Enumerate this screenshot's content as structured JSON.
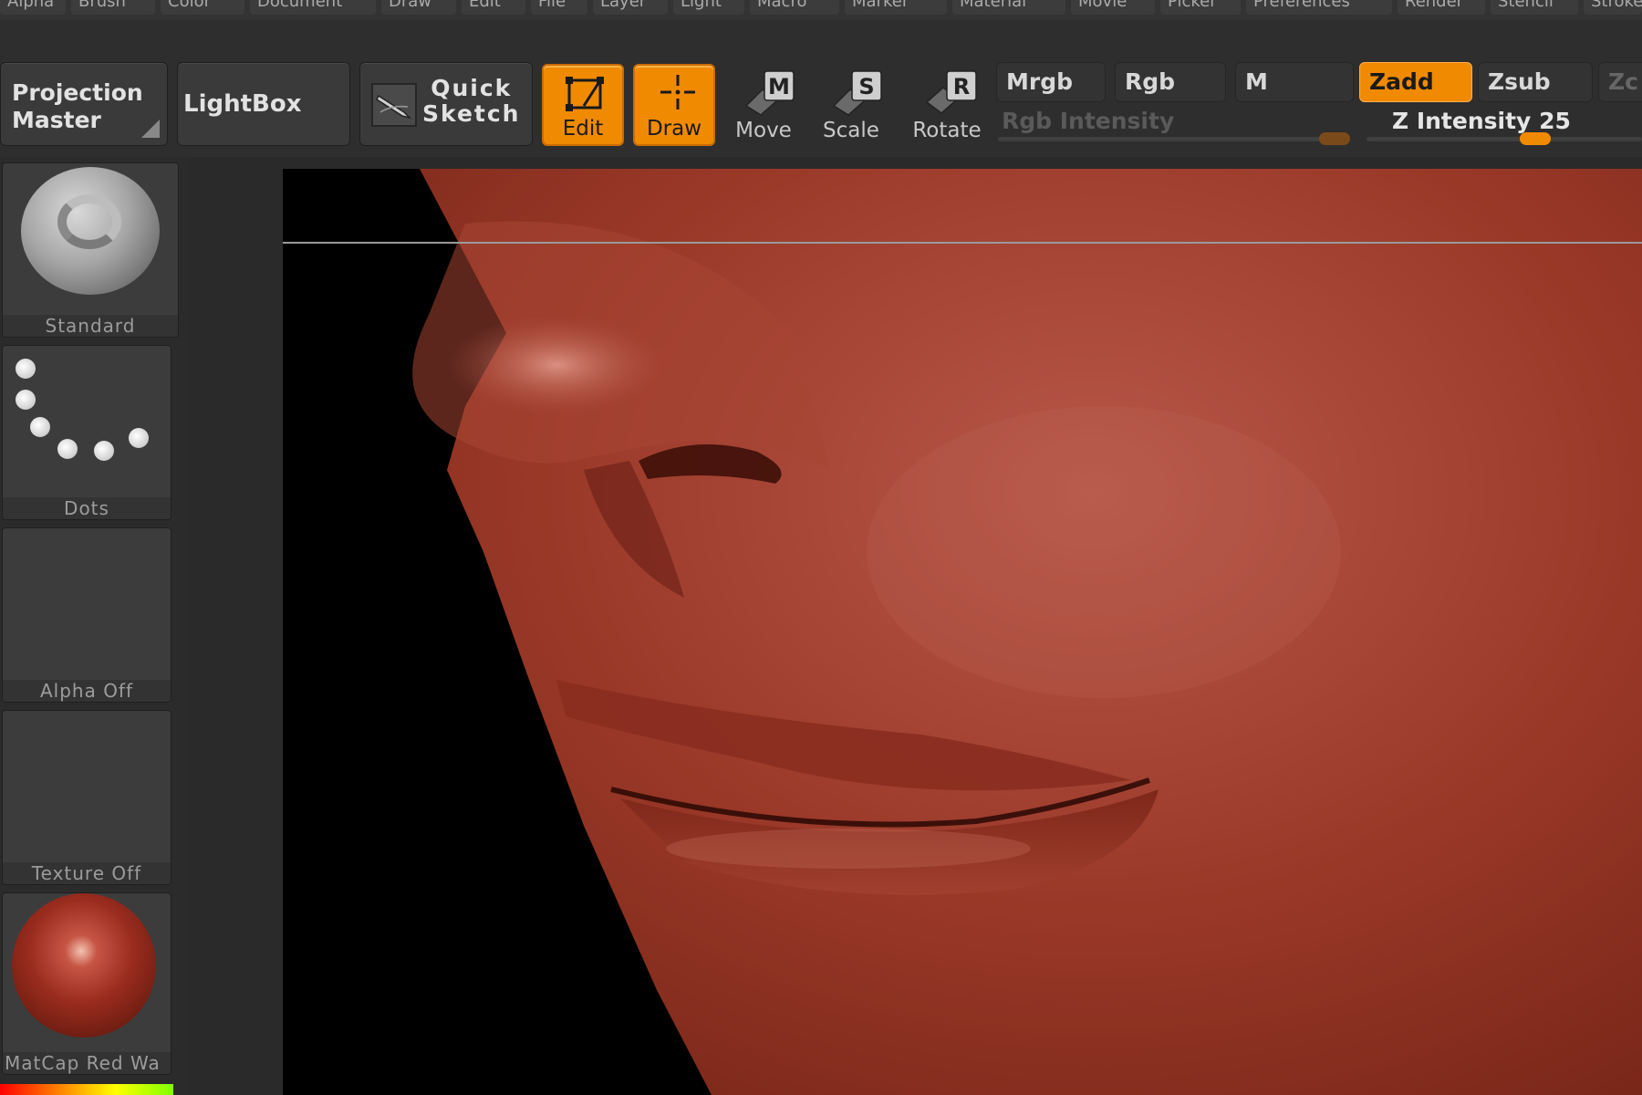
{
  "menu": {
    "items": [
      "Alpha",
      "Brush",
      "Color",
      "Document",
      "Draw",
      "Edit",
      "File",
      "Layer",
      "Light",
      "Macro",
      "Marker",
      "Material",
      "Movie",
      "Picker",
      "Preferences",
      "Render",
      "Stencil",
      "Stroke"
    ]
  },
  "toolbar": {
    "projection_master": "Projection\nMaster",
    "lightbox": "LightBox",
    "quick_sketch": "Quick\nSketch",
    "modes": [
      {
        "label": "Edit",
        "active": true
      },
      {
        "label": "Draw",
        "active": true
      },
      {
        "label": "Move",
        "active": false
      },
      {
        "label": "Scale",
        "active": false
      },
      {
        "label": "Rotate",
        "active": false
      }
    ],
    "color_modes": {
      "mrgb": "Mrgb",
      "rgb": "Rgb",
      "m": "M"
    },
    "depth_modes": {
      "zadd": "Zadd",
      "zsub": "Zsub",
      "zcut": "Zc"
    },
    "rgb_intensity_label": "Rgb Intensity",
    "z_intensity_label": "Z Intensity",
    "z_intensity_value": "25"
  },
  "shelf": {
    "brush": "Standard",
    "stroke": "Dots",
    "alpha": "Alpha Off",
    "texture": "Texture Off",
    "material": "MatCap Red Wa"
  },
  "colors": {
    "accent": "#f08a00",
    "panel": "#3a3a3a",
    "skin": "#9a3a28"
  }
}
